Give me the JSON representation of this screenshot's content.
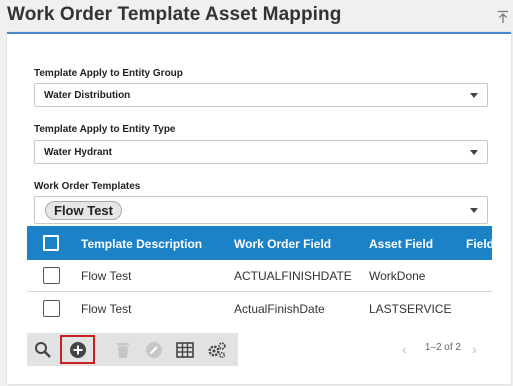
{
  "page": {
    "title": "Work Order Template Asset Mapping"
  },
  "form": {
    "entity_group_label": "Template Apply to Entity Group",
    "entity_group_value": "Water Distribution",
    "entity_type_label": "Template Apply to Entity Type",
    "entity_type_value": "Water Hydrant",
    "templates_label": "Work Order Templates",
    "templates_chip": "Flow Test"
  },
  "grid": {
    "columns": [
      "Template Description",
      "Work Order Field",
      "Asset Field",
      "Field"
    ],
    "rows": [
      [
        "Flow Test",
        "ACTUALFINISHDATE",
        "WorkDone"
      ],
      [
        "Flow Test",
        "ActualFinishDate",
        "LASTSERVICE"
      ]
    ]
  },
  "toolbar": {
    "icons": [
      "search-icon",
      "add-icon",
      "delete-icon",
      "edit-icon",
      "columns-icon",
      "settings-icon"
    ]
  },
  "pager": {
    "label": "1–2 of 2"
  },
  "colors": {
    "accent": "#1c82c8",
    "highlight": "#c82020"
  }
}
